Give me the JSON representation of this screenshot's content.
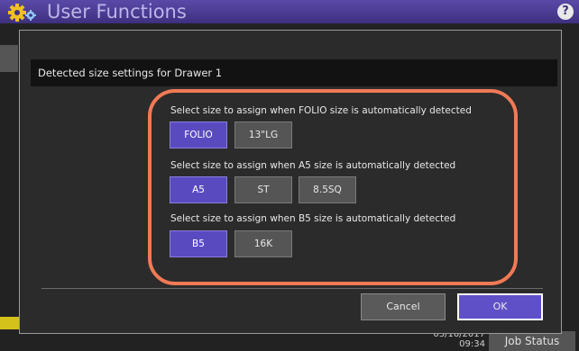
{
  "app": {
    "title": "User Functions"
  },
  "dialog": {
    "title": "Detected size settings for Drawer 1",
    "groups": [
      {
        "label": "Select size to assign when FOLIO size is automatically detected",
        "options": [
          "FOLIO",
          "13\"LG"
        ],
        "selected": "FOLIO"
      },
      {
        "label": "Select size to assign when A5 size is automatically detected",
        "options": [
          "A5",
          "ST",
          "8.5SQ"
        ],
        "selected": "A5"
      },
      {
        "label": "Select size to assign when B5 size is automatically detected",
        "options": [
          "B5",
          "16K"
        ],
        "selected": "B5"
      }
    ],
    "cancel_label": "Cancel",
    "ok_label": "OK"
  },
  "footer": {
    "date": "03/10/2017",
    "time": "09:34",
    "job_status_label": "Job Status"
  },
  "colors": {
    "accent": "#5a4ac0",
    "highlight": "#f07a55",
    "titlebar": "#3e3080"
  },
  "icons": {
    "app_icon": "gear-icon",
    "help": "help-icon"
  }
}
